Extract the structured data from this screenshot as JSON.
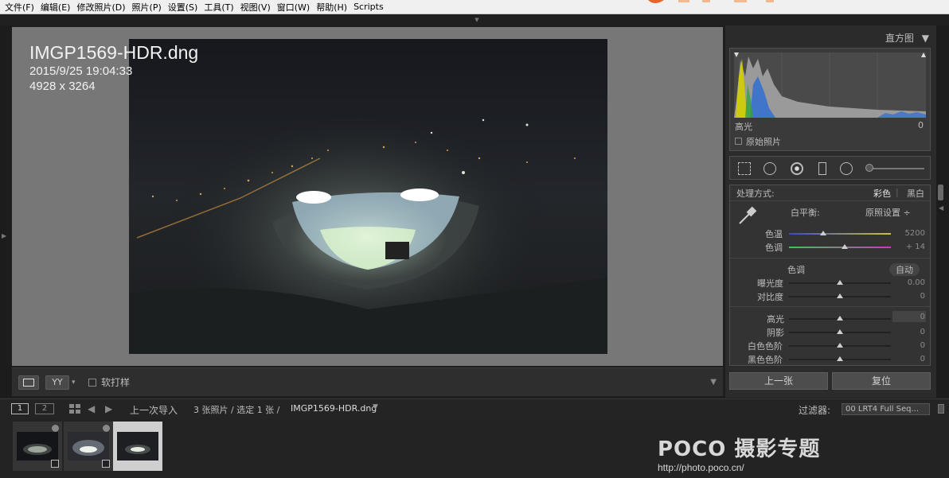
{
  "menu": [
    "文件(F)",
    "编辑(E)",
    "修改照片(D)",
    "照片(P)",
    "设置(S)",
    "工具(T)",
    "视图(V)",
    "窗口(W)",
    "帮助(H)",
    "Scripts"
  ],
  "photo_info": {
    "filename": "IMGP1569-HDR.dng",
    "datetime": "2015/9/25 19:04:33",
    "dimensions": "4928 x 3264"
  },
  "toolbar": {
    "soft_proof_label": "软打样",
    "compare_label": "YY"
  },
  "histogram": {
    "title": "直方图",
    "region_label": "高光",
    "region_value": "0",
    "original_label": "原始照片"
  },
  "basic": {
    "treatment_label": "处理方式:",
    "color_option": "彩色",
    "bw_option": "黑白",
    "wb_label": "白平衡:",
    "wb_value": "原照设置 ÷",
    "temp_label": "色温",
    "temp_value": "5200",
    "tint_label": "色调",
    "tint_value": "+ 14",
    "tone_label": "色调",
    "auto_label": "自动",
    "exposure_label": "曝光度",
    "exposure_value": "0.00",
    "contrast_label": "对比度",
    "contrast_value": "0",
    "highlights_label": "高光",
    "highlights_value": "0",
    "shadows_label": "阴影",
    "shadows_value": "0",
    "whites_label": "白色色阶",
    "whites_value": "0",
    "blacks_label": "黑色色阶",
    "blacks_value": "0"
  },
  "buttons": {
    "previous": "上一张",
    "reset": "复位"
  },
  "filmstrip_bar": {
    "view1": "1",
    "view2": "2",
    "source": "上一次导入",
    "count": "3 张照片 / 选定 1 张 /",
    "current_file": "IMGP1569-HDR.dng",
    "filter_label": "过滤器:",
    "filter_value": "00 LRT4 Full Seq..."
  },
  "watermark": {
    "logo": "POCO 摄影专题",
    "url": "http://photo.poco.cn/"
  },
  "colors": {
    "accent_orange": "#e8642a",
    "panel_bg": "#2b2b2b",
    "loupe_bg": "#777777"
  }
}
